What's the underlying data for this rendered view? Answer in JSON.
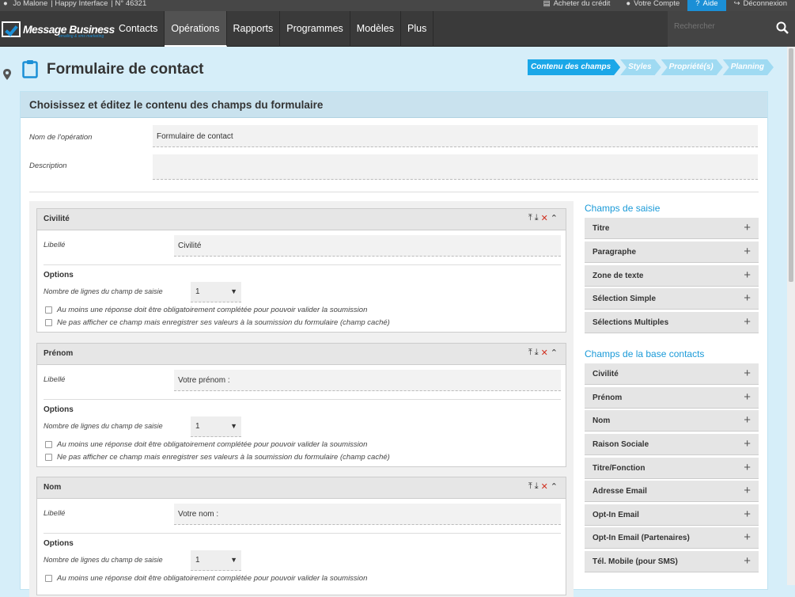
{
  "topbar": {
    "user": "Jo Malone",
    "org": "Happy Interface",
    "account_no": "N° 46321",
    "buy_credit": "Acheter du crédit",
    "account": "Votre Compte",
    "help": "Aide",
    "logout": "Déconnexion"
  },
  "brand": {
    "name": "Message Business",
    "tagline": "emailing & sms marketing"
  },
  "nav": {
    "items": [
      "Contacts",
      "Opérations",
      "Rapports",
      "Programmes",
      "Modèles",
      "Plus"
    ],
    "active": "Opérations",
    "search_placeholder": "Rechercher"
  },
  "page": {
    "title": "Formulaire de contact",
    "steps": [
      "Contenu des champs",
      "Styles",
      "Propriété(s)",
      "Planning"
    ],
    "active_step": "Contenu des champs"
  },
  "card": {
    "heading": "Choisissez et éditez le contenu des champs du formulaire",
    "name_label": "Nom de l'opération",
    "name_value": "Formulaire de contact",
    "desc_label": "Description",
    "desc_value": ""
  },
  "field_labels": {
    "libelle": "Libellé",
    "options": "Options",
    "lines": "Nombre de lignes du champ de saisie",
    "required": "Au moins une réponse doit être obligatoirement complétée pour pouvoir valider la soumission",
    "hidden": "Ne pas afficher ce champ mais enregistrer ses valeurs à la soumission du formulaire (champ caché)"
  },
  "fields": [
    {
      "name": "Civilité",
      "libelle": "Civilité",
      "lines": "1"
    },
    {
      "name": "Prénom",
      "libelle": "Votre prénom :",
      "lines": "1"
    },
    {
      "name": "Nom",
      "libelle": "Votre nom :",
      "lines": "1"
    }
  ],
  "side": {
    "input_heading": "Champs de saisie",
    "input_items": [
      "Titre",
      "Paragraphe",
      "Zone de texte",
      "Sélection Simple",
      "Sélections Multiples"
    ],
    "contacts_heading": "Champs de la base contacts",
    "contact_items": [
      "Civilité",
      "Prénom",
      "Nom",
      "Raison Sociale",
      "Titre/Fonction",
      "Adresse Email",
      "Opt-In Email",
      "Opt-In Email (Partenaires)",
      "Tél. Mobile (pour SMS)"
    ]
  },
  "colors": {
    "accent": "#1aa7e8",
    "nav_bg": "#3a3a3a",
    "page_bg": "#d6eef9"
  }
}
